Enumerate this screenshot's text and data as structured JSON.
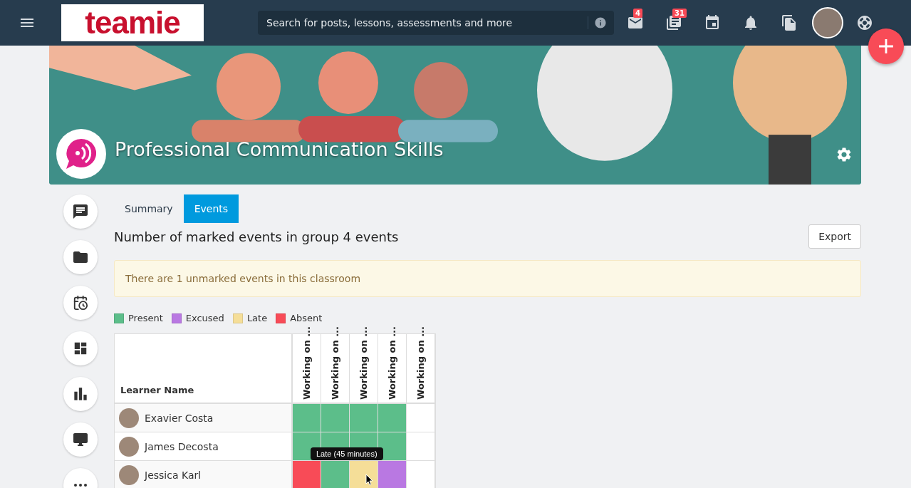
{
  "header": {
    "logo": "teamie",
    "search": {
      "placeholder": "Search for posts, lessons, assessments and more"
    },
    "badges": {
      "messages": "4",
      "posts": "31"
    }
  },
  "banner": {
    "title": "Professional Communication Skills"
  },
  "tabs": [
    {
      "label": "Summary",
      "selected": false
    },
    {
      "label": "Events",
      "selected": true
    }
  ],
  "heading": "Number of marked events in group 4 events",
  "export_button": "Export",
  "notice": "There are 1 unmarked events in this classroom",
  "legend": [
    {
      "label": "Present",
      "color": "#5cbe8a"
    },
    {
      "label": "Excused",
      "color": "#b978e2"
    },
    {
      "label": "Late",
      "color": "#f5de98"
    },
    {
      "label": "Absent",
      "color": "#f84b57"
    }
  ],
  "table": {
    "name_column": "Learner Name",
    "event_columns": [
      "Working on ...",
      "Working on ...",
      "Working on ...",
      "Working on ...",
      "Working on ..."
    ],
    "rows": [
      {
        "name": "Exavier Costa",
        "cells": [
          {
            "marked": true,
            "color": "#5cbe8a"
          },
          {
            "marked": true,
            "color": "#5cbe8a"
          },
          {
            "marked": true,
            "color": "#5cbe8a"
          },
          {
            "marked": true,
            "color": "#5cbe8a"
          },
          {
            "marked": false
          }
        ]
      },
      {
        "name": "James Decosta",
        "cells": [
          {
            "marked": true,
            "color": "#5cbe8a"
          },
          {
            "marked": true,
            "color": "#5cbe8a"
          },
          {
            "marked": true,
            "color": "#5cbe8a"
          },
          {
            "marked": true,
            "color": "#5cbe8a"
          },
          {
            "marked": false
          }
        ]
      },
      {
        "name": "Jessica Karl",
        "cells": [
          {
            "marked": true,
            "color": "#f84b57"
          },
          {
            "marked": true,
            "color": "#5cbe8a"
          },
          {
            "marked": true,
            "color": "#f5de98"
          },
          {
            "marked": true,
            "color": "#b978e2"
          },
          {
            "marked": false
          }
        ]
      }
    ]
  },
  "tooltip": {
    "text": "Late (45 minutes)"
  }
}
